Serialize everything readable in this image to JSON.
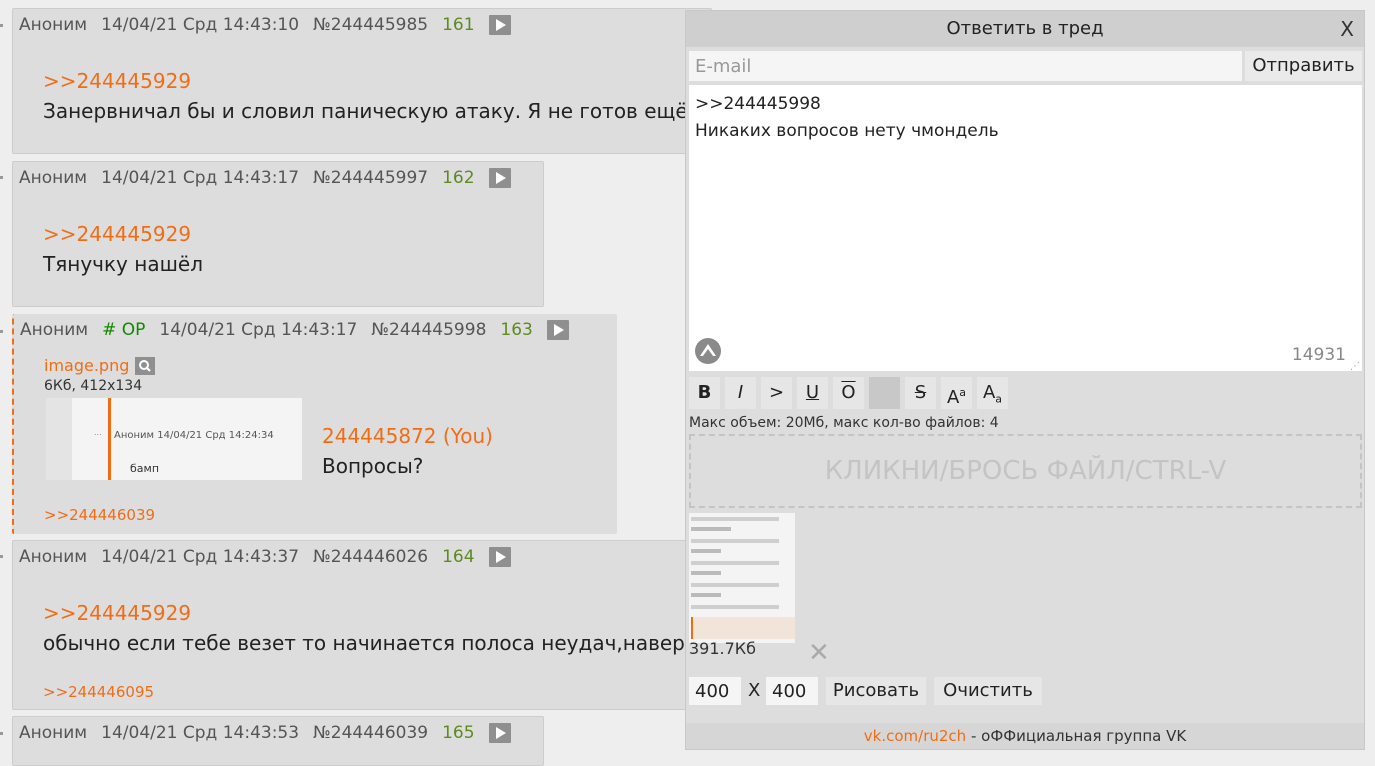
{
  "thread": {
    "posts": [
      {
        "name": "Аноним",
        "date": "14/04/21 Срд 14:43:10",
        "no": "№244445985",
        "count": "161",
        "reply_to": ">>244445929",
        "text": "Занервничал бы и словил паническую атаку. Я не готов ещё к"
      },
      {
        "name": "Аноним",
        "date": "14/04/21 Срд 14:43:17",
        "no": "№244445997",
        "count": "162",
        "reply_to": ">>244445929",
        "text": "Тянучку нашёл"
      },
      {
        "name": "Аноним",
        "op_tag": "# OP",
        "date": "14/04/21 Срд 14:43:17",
        "no": "№244445998",
        "count": "163",
        "file_name": "image.png",
        "file_meta": "6Кб, 412x134",
        "thumb_text": "Аноним 14/04/21 Срд 14:24:34",
        "thumb_sub": "бамп",
        "quote_link": "244445872 (You)",
        "text": "Вопросы?",
        "backref": ">>244446039"
      },
      {
        "name": "Аноним",
        "date": "14/04/21 Срд 14:43:37",
        "no": "№244446026",
        "count": "164",
        "reply_to": ">>244445929",
        "text": "обычно если тебе везет то начинается полоса неудач,наверн",
        "backref": ">>244446095"
      },
      {
        "name": "Аноним",
        "date": "14/04/21 Срд 14:43:53",
        "no": "№244446039",
        "count": "165"
      }
    ]
  },
  "reply_form": {
    "title": "Ответить в тред",
    "close": "X",
    "email_placeholder": "E-mail",
    "send_label": "Отправить",
    "message": ">>244445998\nНикаких вопросов нету чмондель",
    "char_counter": "14931",
    "format_buttons": [
      "B",
      "I",
      ">",
      "U",
      "O",
      "",
      "S",
      "Aa",
      "Aa"
    ],
    "limits": "Макс объем: 20Мб, макс кол-во файлов: 4",
    "dropzone": "КЛИКНИ/БРОСЬ ФАЙЛ/CTRL-V",
    "attachment_size": "391.7Кб",
    "remove_icon": "close-icon",
    "width_value": "400",
    "dim_separator": "X",
    "height_value": "400",
    "draw_label": "Рисовать",
    "clear_label": "Очистить",
    "footer_link": "vk.com/ru2ch",
    "footer_text": " - оФФициальная группа VK"
  },
  "colors": {
    "accent": "#f06d16",
    "post_bg": "#dddddd",
    "page_bg": "#eeeeee",
    "counter_green": "#5c8b22",
    "op_green": "#108a00"
  }
}
